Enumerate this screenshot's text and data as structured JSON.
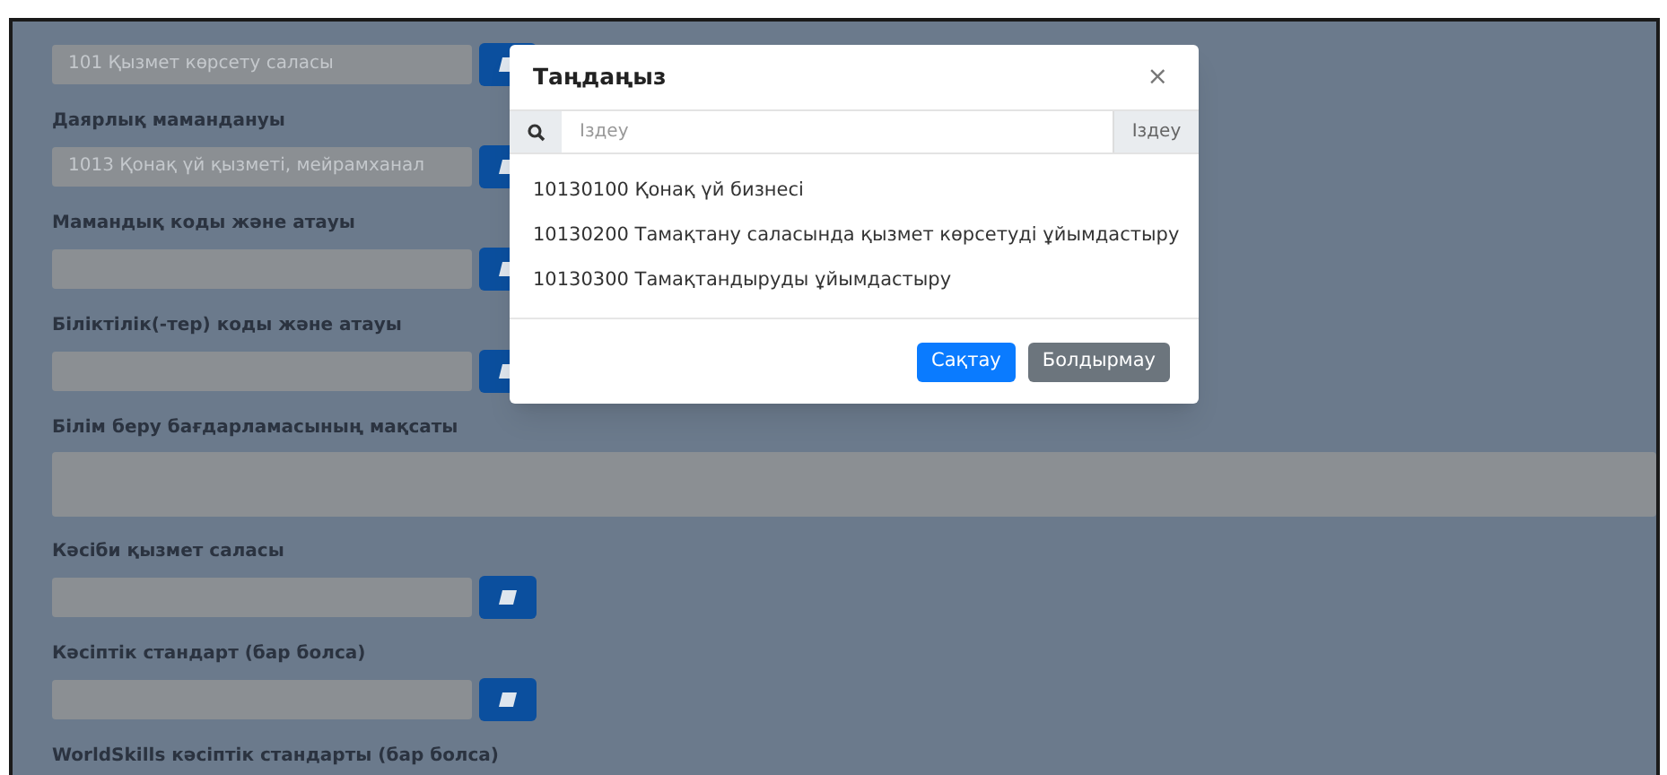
{
  "form": {
    "fields": [
      {
        "kind": "picker",
        "value": "101 Қызмет көрсету саласы"
      },
      {
        "kind": "picker",
        "label": "Даярлық мамандануы",
        "value": "1013 Қонақ үй қызметі, мейрамханал"
      },
      {
        "kind": "picker",
        "label": "Мамандық коды және атауы"
      },
      {
        "kind": "picker",
        "label": "Біліктілік(-тер) коды және атауы"
      },
      {
        "kind": "textarea",
        "label": "Білім беру бағдарламасының мақсаты"
      },
      {
        "kind": "picker",
        "label": "Кәсіби қызмет саласы"
      },
      {
        "kind": "picker",
        "label": "Кәсіптік стандарт (бар болса)"
      },
      {
        "kind": "label",
        "label": "WorldSkills кәсіптік стандарты (бар болса)"
      }
    ]
  },
  "modal": {
    "title": "Таңдаңыз",
    "close": "×",
    "search": {
      "placeholder": "Іздеу",
      "button": "Іздеу"
    },
    "items": [
      {
        "text": "10130100 Қонақ үй бизнесі"
      },
      {
        "text": "10130200 Тамақтану саласында қызмет көрсетуді ұйымдастыру"
      },
      {
        "text": "10130300 Тамақтандыруды ұйымдастыру"
      }
    ],
    "buttons": [
      {
        "kind": "primary",
        "label": "Сақтау"
      },
      {
        "kind": "secondary",
        "label": "Болдырмау"
      }
    ]
  }
}
